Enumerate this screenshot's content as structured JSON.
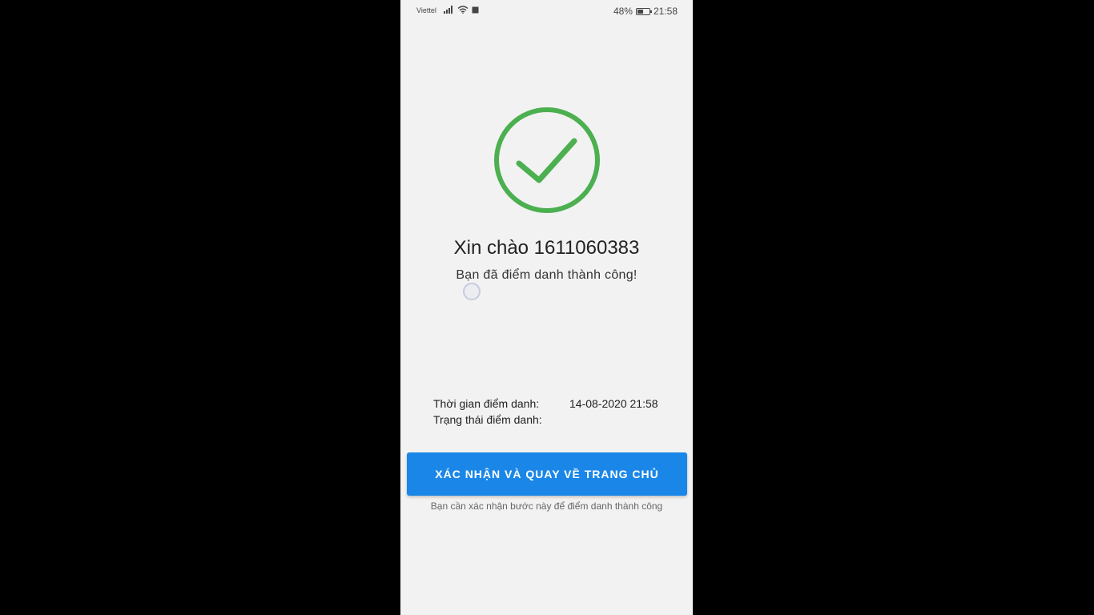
{
  "status_bar": {
    "carrier": "Viettel",
    "battery_percent": "48%",
    "time": "21:58",
    "icons": [
      "signal-icon",
      "wifi-icon",
      "notification-square-icon",
      "battery-icon"
    ]
  },
  "result": {
    "icon": "check-circle-icon",
    "success_color": "#4caf50",
    "greeting": "Xin chào 1611060383",
    "message": "Bạn đã điểm danh thành công!"
  },
  "details": {
    "time_label": "Thời gian điểm danh:",
    "time_value": "14-08-2020 21:58",
    "status_label": "Trạng thái điểm danh:",
    "status_value": ""
  },
  "actions": {
    "confirm_label": "XÁC NHẬN VÀ QUAY VỀ TRANG CHỦ",
    "confirm_color": "#1a87e8",
    "hint": "Bạn cần xác nhận bước này để điểm danh thành công"
  }
}
